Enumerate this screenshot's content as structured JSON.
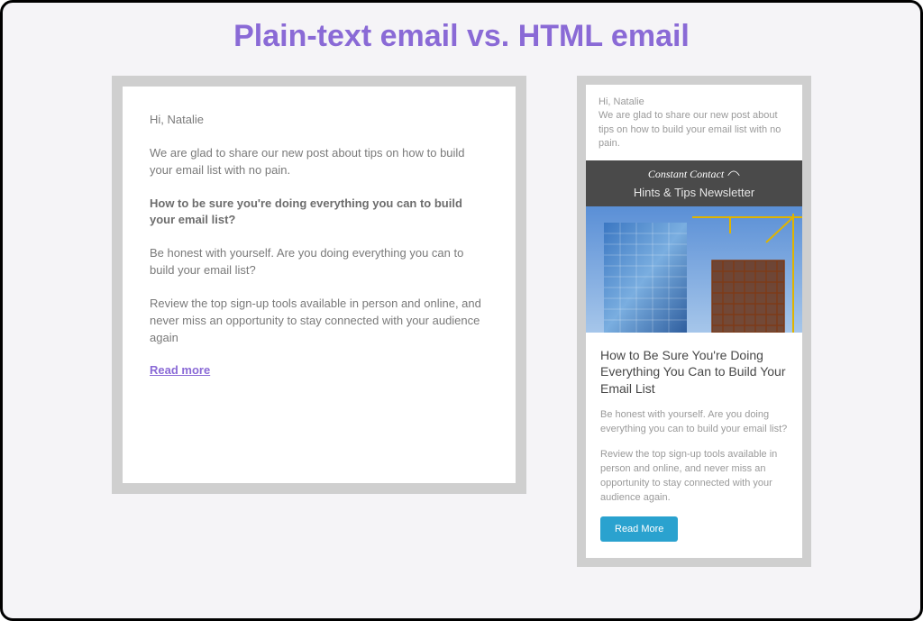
{
  "page": {
    "title": "Plain-text email vs. HTML email"
  },
  "plain_email": {
    "greeting": "Hi, Natalie",
    "intro": "We are glad to share our new post about tips on how to build your email list with no pain.",
    "heading": "How to be sure you're doing everything you can to build your email list?",
    "para1": "Be honest with yourself. Are you doing everything you can to build your email list?",
    "para2": "Review the top sign-up tools available in person and online, and never miss an opportunity to stay connected with your audience again",
    "link": "Read more"
  },
  "html_email": {
    "greeting": "Hi, Natalie",
    "intro": "We are glad to share our new post about tips on how to build your email list with no pain.",
    "brand": "Constant Contact",
    "newsletter_title": "Hints & Tips Newsletter",
    "article_title": "How to Be Sure You're Doing Everything You Can to Build Your Email List",
    "para1": "Be honest with yourself. Are you doing everything you can to build your email list?",
    "para2": "Review the top sign-up tools available in person and online, and never miss an opportunity to stay connected with your audience again.",
    "cta": "Read More"
  }
}
